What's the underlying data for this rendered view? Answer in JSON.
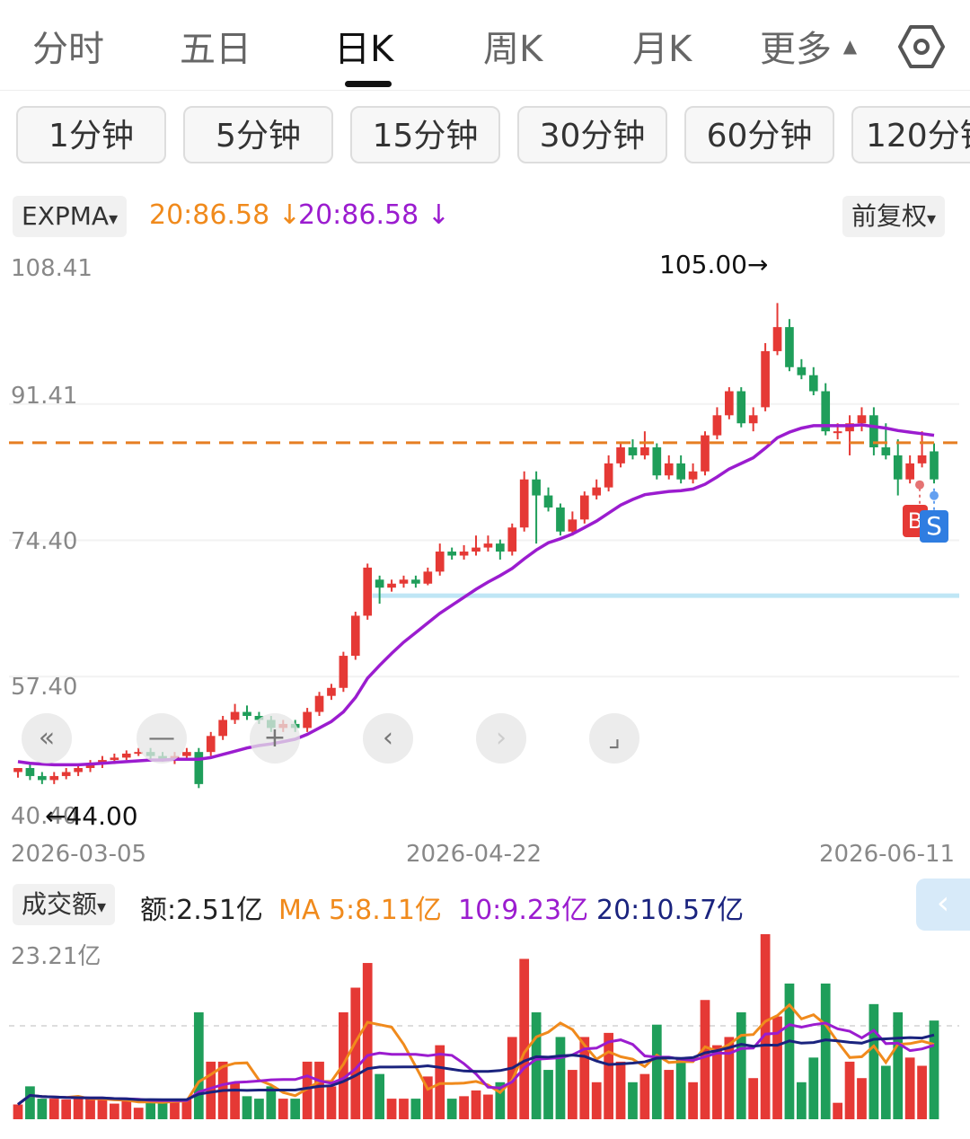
{
  "tabs": [
    {
      "label": "分时",
      "active": false
    },
    {
      "label": "五日",
      "active": false
    },
    {
      "label": "日K",
      "active": true
    },
    {
      "label": "周K",
      "active": false
    },
    {
      "label": "月K",
      "active": false
    },
    {
      "label": "更多",
      "active": false
    }
  ],
  "more_arrow": "▲",
  "settings_icon": "hexagon-gear-icon",
  "intervals": [
    "1分钟",
    "5分钟",
    "15分钟",
    "30分钟",
    "60分钟",
    "120分钟"
  ],
  "indicator": {
    "name": "EXPMA",
    "dropdown": "▾",
    "line1": "20:86.58 ↓",
    "line1_color": "#f08a1c",
    "line2": "20:86.58 ↓",
    "line2_color": "#9b1ccf"
  },
  "adjust": {
    "label": "前复权",
    "dropdown": "▾"
  },
  "price_axis": [
    "108.41",
    "91.41",
    "74.40",
    "57.40",
    "40.40"
  ],
  "high_label": "105.00→",
  "low_label": "←44.00",
  "date_axis": [
    "2026-03-05",
    "2026-04-22",
    "2026-06-11"
  ],
  "volume": {
    "name": "成交额",
    "dropdown": "▾",
    "amount": "额:2.51亿",
    "ma5": "MA 5:8.11亿",
    "ma10": "10:9.23亿",
    "ma20": "20:10.57亿",
    "ma5_color": "#f08a1c",
    "ma10_color": "#9b1ccf",
    "ma20_color": "#1a237e",
    "max_label": "23.21亿"
  },
  "controls": [
    "«",
    "—",
    "+",
    "‹",
    "›",
    "⌟"
  ],
  "colors": {
    "up": "#e53935",
    "down": "#1f9e5a",
    "ref_line": "#e67e22",
    "support": "#bfe6f5"
  },
  "badges": {
    "b": "B",
    "s": "S"
  },
  "chart_data": {
    "type": "candlestick",
    "ylim": [
      40.4,
      108.41
    ],
    "reference_line": 86.58,
    "support_line": 67.5,
    "candles": [
      [
        45.5,
        46,
        44.8,
        45.6
      ],
      [
        46,
        45,
        44.5,
        46.5
      ],
      [
        45,
        44.5,
        44,
        45.5
      ],
      [
        44.5,
        45,
        44,
        45.5
      ],
      [
        45,
        45.5,
        44.6,
        46
      ],
      [
        45.5,
        46,
        45,
        46.5
      ],
      [
        46,
        46.5,
        45.5,
        47
      ],
      [
        46.5,
        47,
        46,
        47.5
      ],
      [
        47,
        47.3,
        46.5,
        47.8
      ],
      [
        47.3,
        47.8,
        47,
        48.2
      ],
      [
        47.8,
        48,
        47.5,
        48.5
      ],
      [
        48,
        47.5,
        47,
        48.5
      ],
      [
        47.5,
        47,
        46.8,
        48
      ],
      [
        47,
        47.5,
        46.5,
        48
      ],
      [
        47.5,
        48,
        47,
        48.5
      ],
      [
        48,
        44,
        43.5,
        48.5
      ],
      [
        48,
        50,
        47.5,
        50.5
      ],
      [
        50,
        52,
        49.5,
        52.5
      ],
      [
        52,
        53,
        51.5,
        54
      ],
      [
        53,
        52.5,
        52,
        53.8
      ],
      [
        52.5,
        52,
        51.5,
        53
      ],
      [
        52,
        51,
        50.5,
        52.5
      ],
      [
        51,
        51.5,
        50.5,
        52
      ],
      [
        51.5,
        51,
        50.5,
        52
      ],
      [
        51,
        53,
        50.5,
        53.5
      ],
      [
        53,
        55,
        52.5,
        55.5
      ],
      [
        55,
        56,
        54.5,
        56.5
      ],
      [
        56,
        60,
        55.5,
        60.5
      ],
      [
        60,
        65,
        59.5,
        65.5
      ],
      [
        65,
        71,
        64.5,
        71.5
      ],
      [
        69.5,
        68.5,
        66.5,
        70
      ],
      [
        68.5,
        69,
        68,
        69.5
      ],
      [
        69,
        69.5,
        68.5,
        70
      ],
      [
        69.5,
        69,
        68.5,
        70
      ],
      [
        69,
        70.5,
        68.8,
        71
      ],
      [
        70.5,
        73,
        70,
        74
      ],
      [
        73,
        72.5,
        72,
        73.5
      ],
      [
        72.5,
        73,
        72,
        73.8
      ],
      [
        73,
        73.5,
        72.5,
        75
      ],
      [
        73.5,
        74,
        73,
        75
      ],
      [
        74,
        73,
        72,
        74.5
      ],
      [
        73,
        76,
        72.5,
        76.5
      ],
      [
        76,
        82,
        75.5,
        83
      ],
      [
        82,
        80,
        74,
        83
      ],
      [
        80,
        78.5,
        78,
        81
      ],
      [
        78.5,
        75.5,
        75,
        79
      ],
      [
        75.5,
        77,
        75,
        78
      ],
      [
        77,
        80,
        76.5,
        80.5
      ],
      [
        80,
        81,
        79.5,
        82
      ],
      [
        81,
        84,
        80.5,
        85
      ],
      [
        84,
        86,
        83.5,
        86.5
      ],
      [
        86,
        85,
        84.5,
        87
      ],
      [
        85,
        86,
        84.5,
        88
      ],
      [
        86,
        82.5,
        82,
        86.5
      ],
      [
        82.5,
        84,
        82,
        85
      ],
      [
        84,
        82,
        81.5,
        85
      ],
      [
        82,
        83,
        81.5,
        84
      ],
      [
        83,
        87.5,
        82.5,
        88
      ],
      [
        87.5,
        90,
        87,
        91
      ],
      [
        90,
        93,
        89.5,
        93.5
      ],
      [
        93,
        89,
        88.5,
        93.5
      ],
      [
        89,
        90,
        88,
        91
      ],
      [
        91,
        98,
        90.5,
        99
      ],
      [
        98,
        101,
        97.5,
        104
      ],
      [
        101,
        96,
        95.5,
        102
      ],
      [
        96,
        95,
        94.5,
        97
      ],
      [
        95,
        93,
        92.5,
        96
      ],
      [
        93,
        88,
        87.5,
        94
      ],
      [
        88,
        88,
        87,
        89
      ],
      [
        88,
        89,
        85,
        90
      ],
      [
        89,
        90,
        88,
        91
      ],
      [
        90,
        86,
        85,
        91
      ],
      [
        86,
        85,
        84.5,
        89
      ],
      [
        85,
        82,
        80,
        87
      ],
      [
        82,
        84,
        81.5,
        85
      ],
      [
        84,
        85,
        83.5,
        88
      ],
      [
        85.5,
        82,
        81.5,
        86.5
      ]
    ],
    "ema20": [
      46.8,
      46.6,
      46.5,
      46.4,
      46.4,
      46.4,
      46.5,
      46.6,
      46.7,
      46.8,
      46.9,
      47,
      47,
      47.1,
      47.1,
      47.1,
      47.3,
      47.7,
      48.1,
      48.5,
      48.8,
      49,
      49.3,
      49.6,
      50.2,
      51,
      51.8,
      53,
      54.8,
      57.2,
      58.8,
      60.3,
      61.7,
      62.9,
      64.1,
      65.3,
      66.3,
      67.3,
      68.3,
      69.2,
      70,
      70.9,
      72.1,
      73.2,
      74.1,
      74.6,
      75.2,
      76,
      76.8,
      77.8,
      78.8,
      79.5,
      80.1,
      80.3,
      80.5,
      80.6,
      80.8,
      81.4,
      82.3,
      83.3,
      84,
      84.7,
      85.9,
      87.2,
      87.9,
      88.4,
      88.7,
      88.7,
      88.7,
      88.7,
      88.8,
      88.6,
      88.4,
      88.1,
      87.9,
      87.7,
      87.5
    ]
  }
}
